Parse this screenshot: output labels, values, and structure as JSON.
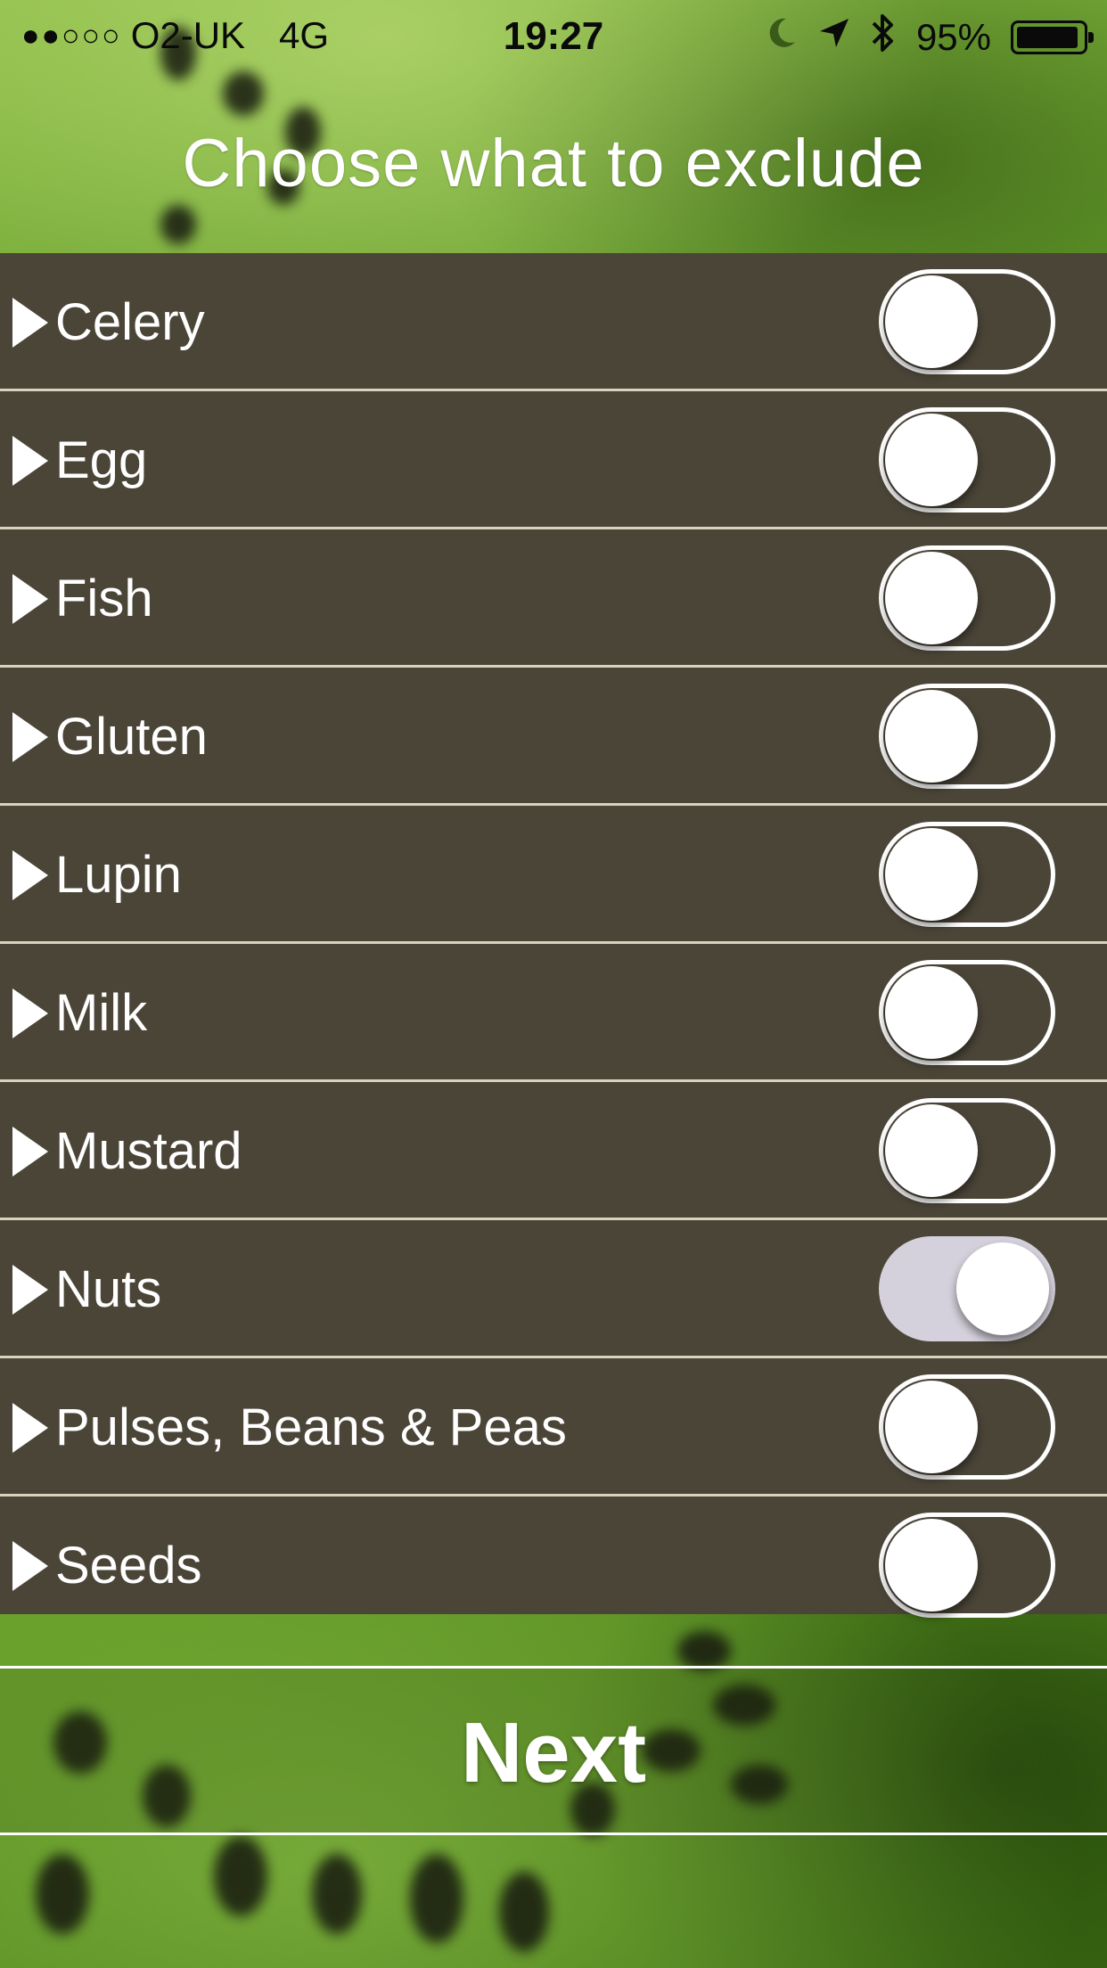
{
  "status_bar": {
    "signal_dots": "●●○○○",
    "carrier": "O2-UK",
    "network": "4G",
    "time": "19:27",
    "battery_percent": "95%",
    "battery_level": 0.95,
    "icons": [
      "moon-icon",
      "location-arrow-icon",
      "bluetooth-icon",
      "battery-icon"
    ]
  },
  "header": {
    "title": "Choose what to exclude"
  },
  "allergens": [
    {
      "label": "Celery",
      "on": false
    },
    {
      "label": "Egg",
      "on": false
    },
    {
      "label": "Fish",
      "on": false
    },
    {
      "label": "Gluten",
      "on": false
    },
    {
      "label": "Lupin",
      "on": false
    },
    {
      "label": "Milk",
      "on": false
    },
    {
      "label": "Mustard",
      "on": false
    },
    {
      "label": "Nuts",
      "on": true
    },
    {
      "label": "Pulses, Beans & Peas",
      "on": false
    },
    {
      "label": "Seeds",
      "on": false
    }
  ],
  "footer": {
    "next_label": "Next"
  },
  "colors": {
    "list_background": "#4b4538",
    "divider": "#d7d3be",
    "toggle_on_track": "#d5d1dc"
  }
}
